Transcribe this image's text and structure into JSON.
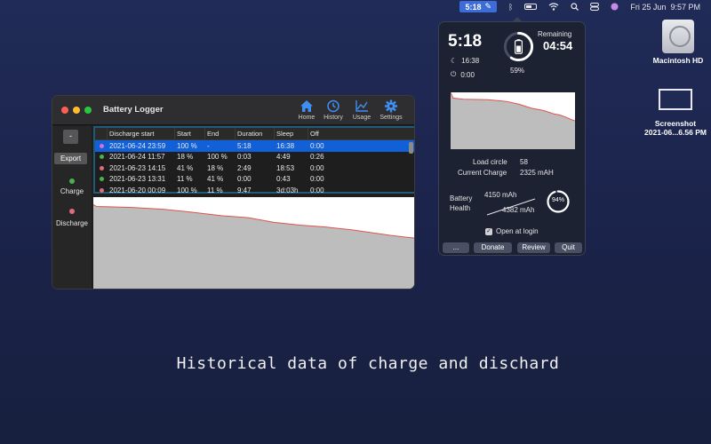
{
  "menubar": {
    "app_time": "5:18",
    "date": "Fri 25 Jun",
    "time": "9:57 PM"
  },
  "desktop": {
    "icons": [
      {
        "label": "Macintosh HD"
      },
      {
        "label": "Screenshot",
        "sublabel": "2021-06...6.56 PM"
      }
    ]
  },
  "window": {
    "title": "Battery Logger",
    "toolbar": [
      "Home",
      "History",
      "Usage",
      "Settings"
    ],
    "sidebar": {
      "minus_label": "-",
      "export_label": "Export",
      "charge_label": "Charge",
      "discharge_label": "Discharge"
    },
    "table": {
      "columns": [
        "Discharge start",
        "Start",
        "End",
        "Duration",
        "Sleep",
        "Off"
      ],
      "rows": [
        {
          "dot": "#d86fd8",
          "cells": [
            "2021-06-24 23:59",
            "100 %",
            "-",
            "5:18",
            "16:38",
            "0:00"
          ]
        },
        {
          "dot": "#4caf50",
          "cells": [
            "2021-06-24 11:57",
            "18 %",
            "100 %",
            "0:03",
            "4:49",
            "0:26"
          ]
        },
        {
          "dot": "#e06b7a",
          "cells": [
            "2021-06-23 14:15",
            "41 %",
            "18 %",
            "2:49",
            "18:53",
            "0:00"
          ]
        },
        {
          "dot": "#4caf50",
          "cells": [
            "2021-06-23 13:31",
            "11 %",
            "41 %",
            "0:00",
            "0:43",
            "0:00"
          ]
        },
        {
          "dot": "#e06b7a",
          "cells": [
            "2021-06-20 00:09",
            "100 %",
            "11 %",
            "9:47",
            "3d:03h",
            "0:00"
          ]
        }
      ]
    }
  },
  "popover": {
    "time": "5:18",
    "sleep_time": "16:38",
    "off_time": "0:00",
    "percent": "59%",
    "percent_value": 0.59,
    "remaining_label": "Remaining",
    "remaining": "04:54",
    "load_circle_label": "Load circle",
    "load_circle": "58",
    "current_charge_label": "Current Charge",
    "current_charge": "2325 mAH",
    "health_label_1": "Battery",
    "health_label_2": "Health",
    "design_capacity": "4150 mAh",
    "max_capacity": "4382 mAh",
    "health_pct": "94%",
    "health_value": 0.94,
    "open_at_login": "Open at login",
    "buttons": [
      "...",
      "Donate",
      "Review",
      "Quit"
    ]
  },
  "caption": "Historical data of charge and dischard",
  "colors": {
    "accent": "#1160d8",
    "graph_fill": "#bdbdbd",
    "graph_line": "#e0534f"
  }
}
